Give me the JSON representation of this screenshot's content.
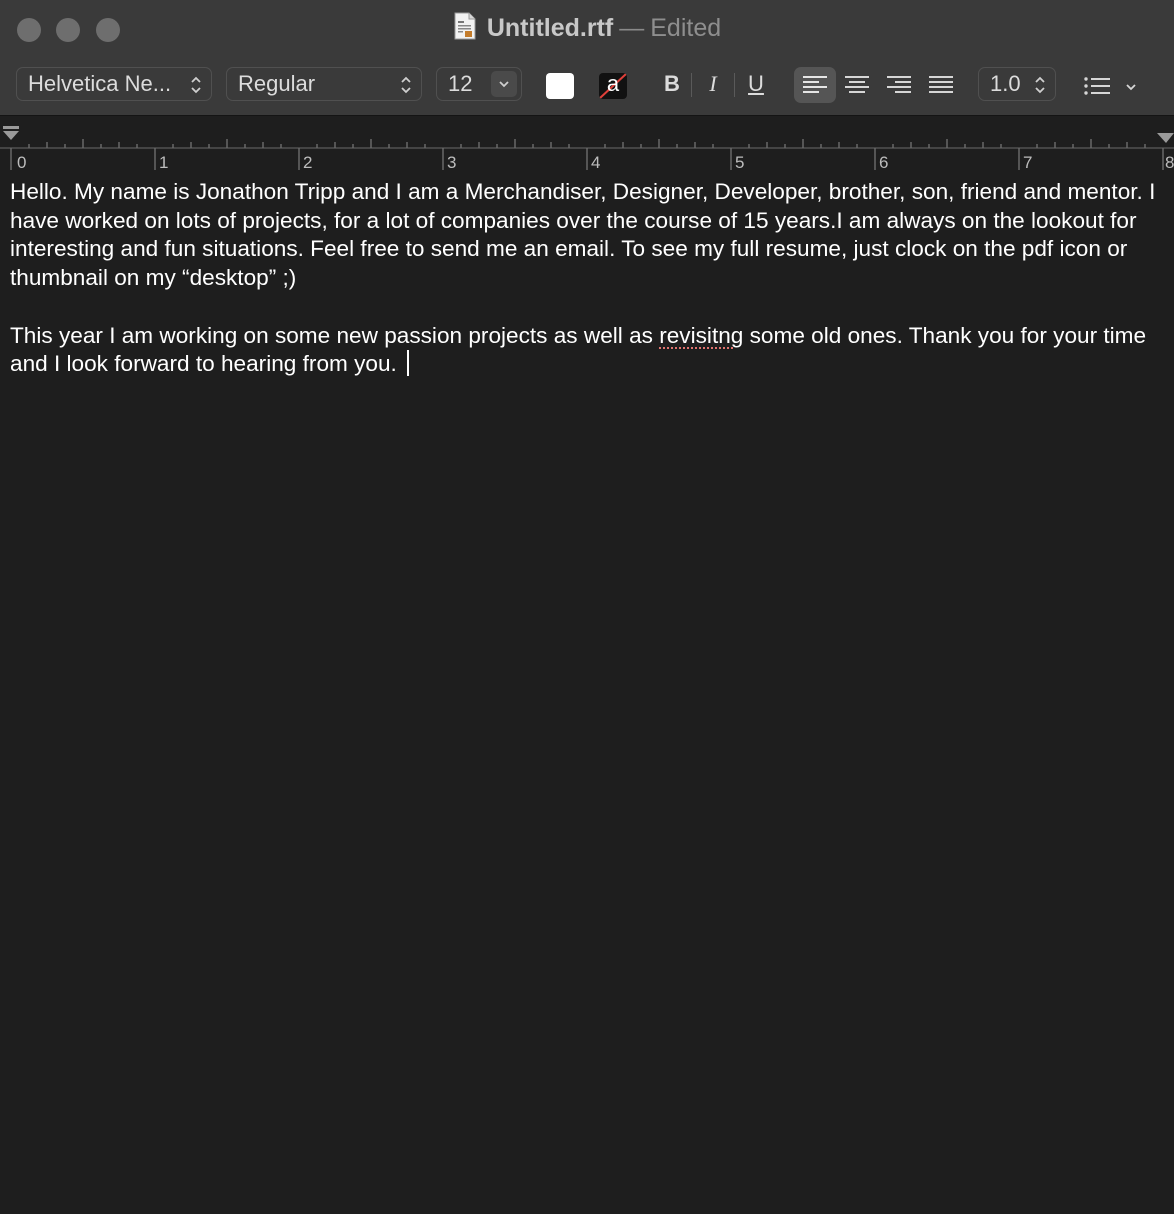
{
  "window": {
    "file_name": "Untitled.rtf",
    "separator": "—",
    "status": "Edited"
  },
  "toolbar": {
    "font_family": "Helvetica Ne...",
    "font_style": "Regular",
    "font_size": "12",
    "text_color": "#ffffff",
    "highlight_glyph": "a",
    "bold_label": "B",
    "italic_label": "I",
    "underline_label": "U",
    "line_spacing": "1.0",
    "alignment_selected": "left"
  },
  "ruler": {
    "numbers": [
      "0",
      "1",
      "2",
      "3",
      "4",
      "5",
      "6",
      "7",
      "8"
    ]
  },
  "document": {
    "paragraph1": "Hello. My name is Jonathon Tripp and I am a Merchandiser, Designer, Developer, brother, son, friend and mentor. I have worked on lots of projects, for a lot of companies over the course of 15 years.I am always on the lookout for interesting and fun situations. Feel free to send me an email. To see my full resume, just clock on the pdf icon or thumbnail on my “desktop” ;)",
    "paragraph2_before": "This year I am working on some new passion projects as well as ",
    "paragraph2_misspelled": "revisitng",
    "paragraph2_after": " some old ones. Thank you for your time and I look forward to hearing from you. "
  }
}
